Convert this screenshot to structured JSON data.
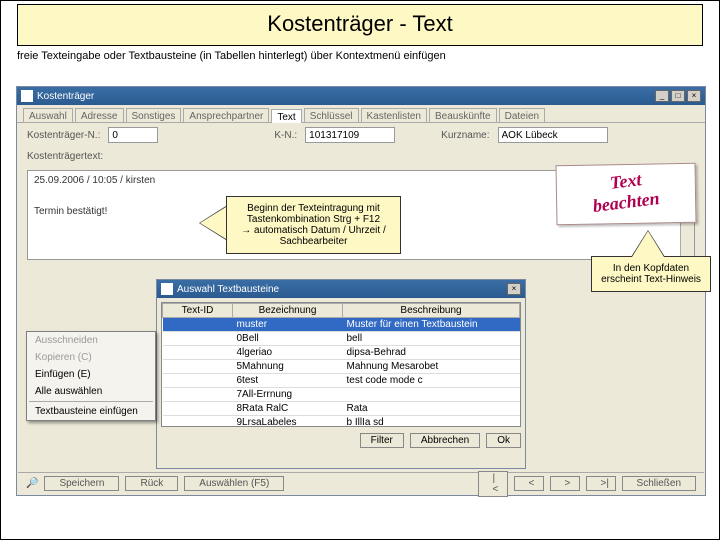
{
  "slide": {
    "title": "Kostenträger - Text",
    "caption": "freie Texteingabe oder Textbausteine (in Tabellen hinterlegt) über Kontextmenü einfügen"
  },
  "main_window": {
    "title": "Kostenträger",
    "tabs": [
      "Auswahl",
      "Adresse",
      "Sonstiges",
      "Ansprechpartner",
      "Text",
      "Schlüssel",
      "Kastenlisten",
      "Beauskünfte",
      "Dateien"
    ],
    "active_tab": "Text",
    "fields": {
      "kt_nr_label": "Kostenträger-N.:",
      "kt_nr_value": "0",
      "kn_label": "K-N.:",
      "kn_value": "101317109",
      "kurzname_label": "Kurzname:",
      "kurzname_value": "AOK Lübeck",
      "kttext_label": "Kostenträgertext:"
    },
    "textarea": {
      "line1": "25.09.2006 / 10:05 / kirsten",
      "line2": "Termin bestätigt!"
    }
  },
  "note": {
    "line1": "Text",
    "line2": "beachten"
  },
  "callout1": {
    "l1": "Beginn der Texteintragung mit",
    "l2": "Tastenkombination Strg + F12",
    "l3": "→ automatisch Datum / Uhrzeit /",
    "l4": "Sachbearbeiter"
  },
  "callout2": {
    "l1": "In den Kopfdaten",
    "l2": "erscheint Text-Hinweis"
  },
  "context_menu": {
    "cut": "Ausschneiden",
    "copy": "Kopieren (C)",
    "paste": "Einfügen (E)",
    "selectall": "Alle auswählen",
    "insert_tb": "Textbausteine einfügen"
  },
  "dialog": {
    "title": "Auswahl Textbausteine",
    "headers": [
      "Text-ID",
      "Bezeichnung",
      "Beschreibung"
    ],
    "rows": [
      [
        "",
        "muster",
        "Muster für einen Textbaustein"
      ],
      [
        "",
        "0Bell",
        "bell"
      ],
      [
        "",
        "4lgeriao",
        "dipsa-Behrad"
      ],
      [
        "",
        "5Mahnung",
        "Mahnung Mesarobet"
      ],
      [
        "",
        "6test",
        "test code mode c"
      ],
      [
        "",
        "7All-Errnung",
        ""
      ],
      [
        "",
        "8Rata RalC",
        "Rata"
      ],
      [
        "",
        "9LrsaLabeles",
        "b IllIa sd"
      ]
    ],
    "buttons": {
      "filter": "Filter",
      "cancel": "Abbrechen",
      "ok": "Ok"
    }
  },
  "footer": {
    "speichern": "Speichern",
    "ruck": "Rück",
    "auswahlen": "Auswählen (F5)",
    "schliessen": "Schließen"
  }
}
